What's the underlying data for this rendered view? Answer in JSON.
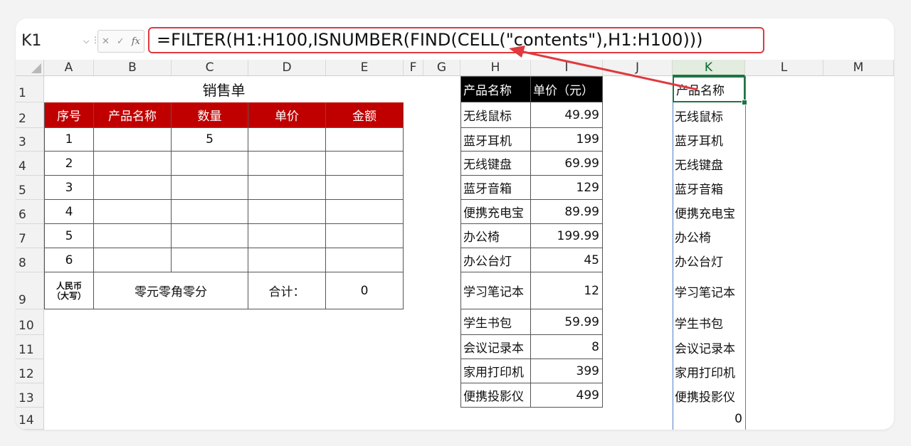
{
  "formula_bar": {
    "name_box": "K1",
    "formula": "=FILTER(H1:H100,ISNUMBER(FIND(CELL(\"contents\"),H1:H100)))"
  },
  "columns": [
    "A",
    "B",
    "C",
    "D",
    "E",
    "F",
    "G",
    "H",
    "I",
    "J",
    "K",
    "L",
    "M"
  ],
  "rows": [
    "1",
    "2",
    "3",
    "4",
    "5",
    "6",
    "7",
    "8",
    "9",
    "10",
    "11",
    "12",
    "13",
    "14"
  ],
  "sales": {
    "title": "销售单",
    "headers": [
      "序号",
      "产品名称",
      "数量",
      "单价",
      "金额"
    ],
    "rows": [
      {
        "no": "1",
        "name": "",
        "qty": "5",
        "price": "",
        "amount": ""
      },
      {
        "no": "2",
        "name": "",
        "qty": "",
        "price": "",
        "amount": ""
      },
      {
        "no": "3",
        "name": "",
        "qty": "",
        "price": "",
        "amount": ""
      },
      {
        "no": "4",
        "name": "",
        "qty": "",
        "price": "",
        "amount": ""
      },
      {
        "no": "5",
        "name": "",
        "qty": "",
        "price": "",
        "amount": ""
      },
      {
        "no": "6",
        "name": "",
        "qty": "",
        "price": "",
        "amount": ""
      }
    ],
    "rmb_line1": "人民币",
    "rmb_line2": "（大写）",
    "rmb_text": "零元零角零分",
    "total_label": "合计：",
    "total_value": "0"
  },
  "products": {
    "header_name": "产品名称",
    "header_price": "单价（元）",
    "items": [
      {
        "name": "无线鼠标",
        "price": "49.99"
      },
      {
        "name": "蓝牙耳机",
        "price": "199"
      },
      {
        "name": "无线键盘",
        "price": "69.99"
      },
      {
        "name": "蓝牙音箱",
        "price": "129"
      },
      {
        "name": "便携充电宝",
        "price": "89.99"
      },
      {
        "name": "办公椅",
        "price": "199.99"
      },
      {
        "name": "办公台灯",
        "price": "45"
      },
      {
        "name": "学习笔记本",
        "price": "12"
      },
      {
        "name": "学生书包",
        "price": "59.99"
      },
      {
        "name": "会议记录本",
        "price": "8"
      },
      {
        "name": "家用打印机",
        "price": "399"
      },
      {
        "name": "便携投影仪",
        "price": "499"
      }
    ]
  },
  "filter_result": {
    "header": "产品名称",
    "items": [
      "无线鼠标",
      "蓝牙耳机",
      "无线键盘",
      "蓝牙音箱",
      "便携充电宝",
      "办公椅",
      "办公台灯",
      "学习笔记本",
      "学生书包",
      "会议记录本",
      "家用打印机",
      "便携投影仪"
    ],
    "trailing_value": "0"
  },
  "colors": {
    "accent_red": "#c00000",
    "highlight_red": "#e0393e",
    "selection_green": "#217346"
  }
}
